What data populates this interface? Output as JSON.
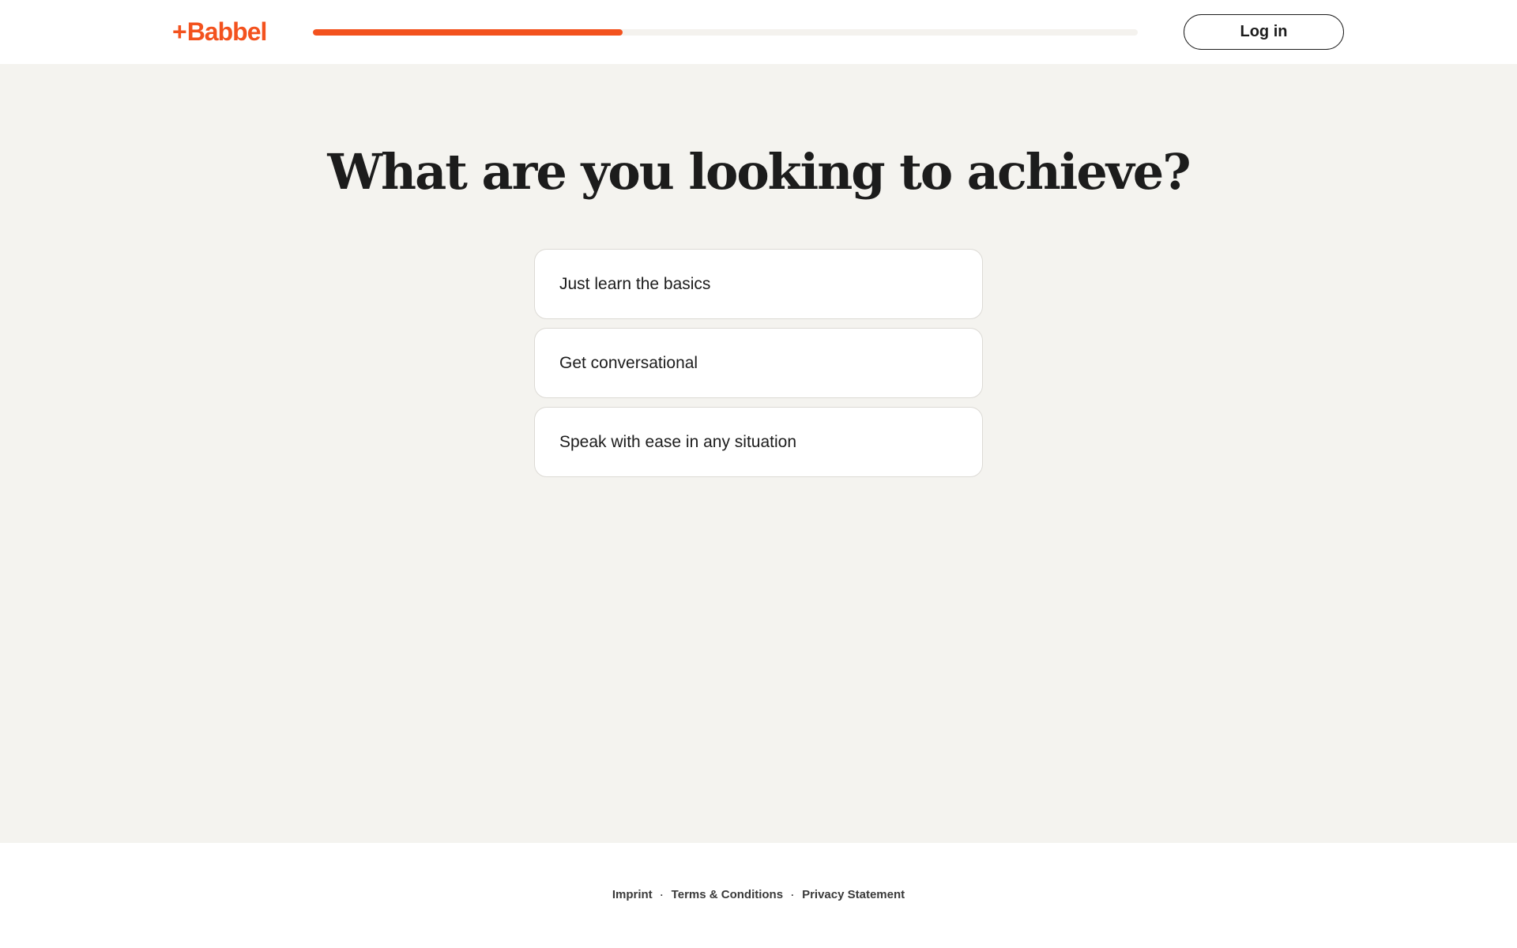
{
  "header": {
    "logo_plus": "+",
    "logo_text": "Babbel",
    "progress": 0.375,
    "login_label": "Log in"
  },
  "main": {
    "title": "What are you looking to achieve?",
    "options": [
      {
        "label": "Just learn the basics"
      },
      {
        "label": "Get conversational"
      },
      {
        "label": "Speak with ease in any situation"
      }
    ]
  },
  "footer": {
    "links": [
      "Imprint",
      "Terms & Conditions",
      "Privacy Statement"
    ],
    "separator": "·"
  },
  "colors": {
    "brand": "#f3521e",
    "page_background": "#f4f3ef"
  }
}
